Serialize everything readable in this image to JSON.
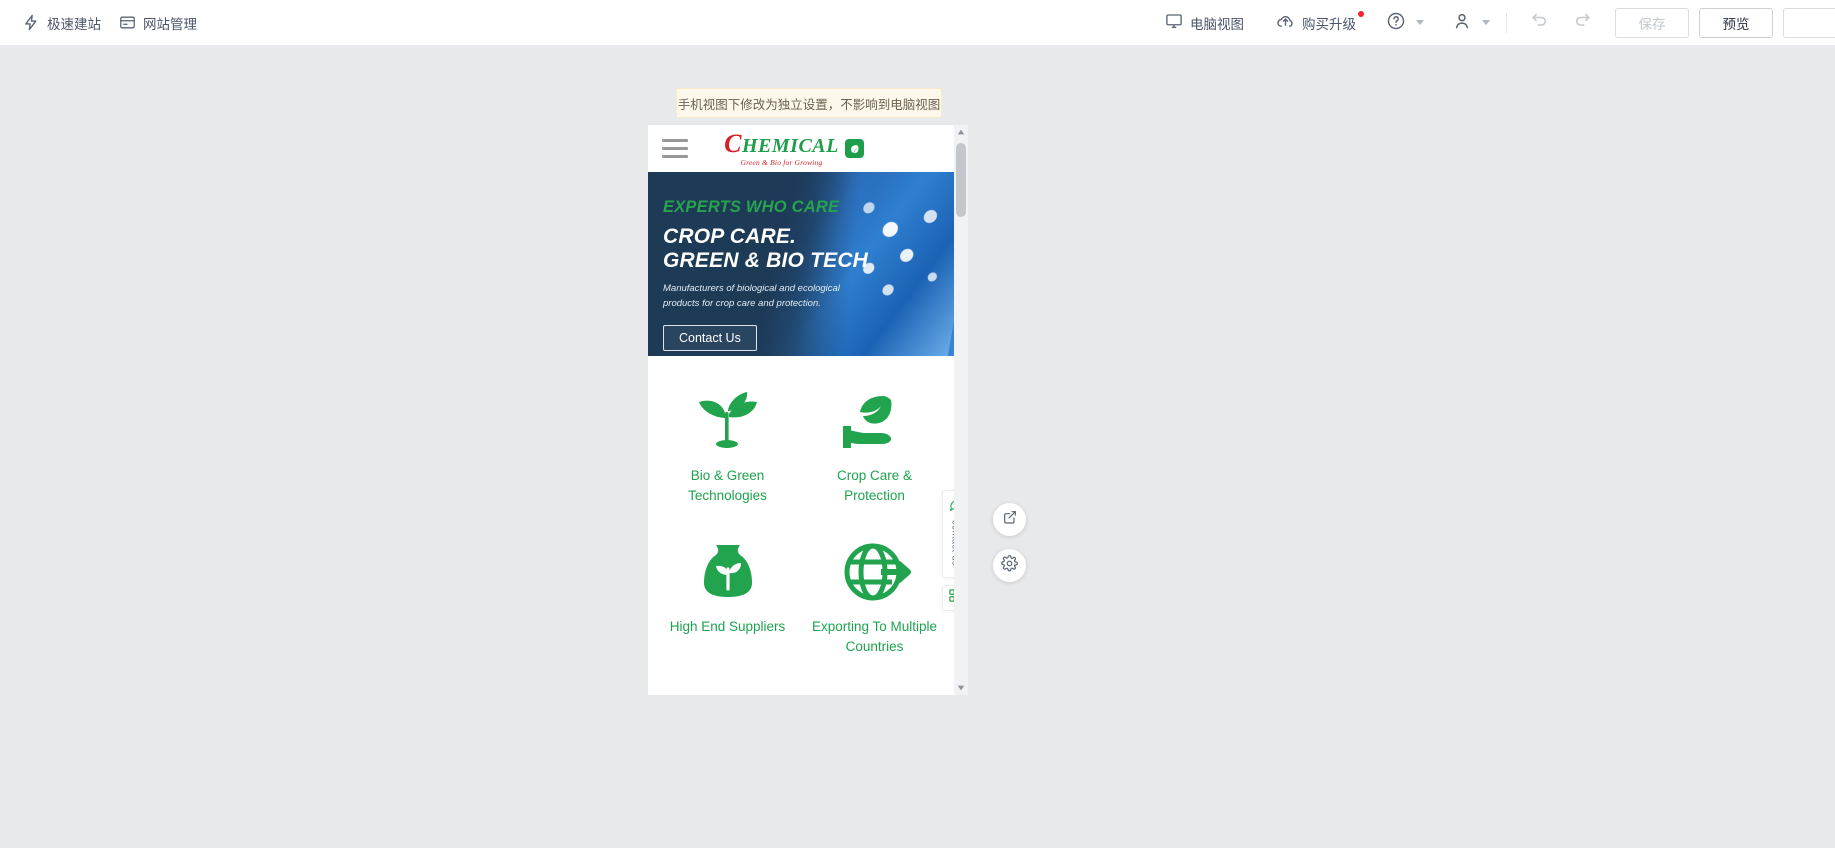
{
  "topbar": {
    "brand": {
      "icon": "lightning-icon",
      "label": "极速建站"
    },
    "site_manage": {
      "icon": "window-icon",
      "label": "网站管理"
    },
    "desktop_view": {
      "icon": "monitor-icon",
      "label": "电脑视图"
    },
    "upgrade": {
      "icon": "cloud-upload-icon",
      "label": "购买升级",
      "badge": true
    },
    "help": {
      "icon": "question-circle-icon"
    },
    "account": {
      "icon": "user-icon"
    },
    "undo": {
      "icon": "undo-icon"
    },
    "redo": {
      "icon": "redo-icon"
    },
    "save_label": "保存",
    "preview_label": "预览",
    "third_label": ""
  },
  "notice": {
    "text": "手机视图下修改为独立设置，不影响到电脑视图"
  },
  "site": {
    "header": {
      "menu_icon": "hamburger-icon",
      "logo_initial": "C",
      "logo_rest": "HEMICAL",
      "logo_tagline": "Green & Bio for Growing",
      "logo_badge_icon": "leaf-badge-icon"
    },
    "hero": {
      "eyebrow": "EXPERTS WHO CARE",
      "title_line1": "CROP CARE.",
      "title_line2": "GREEN & BIO TECH",
      "subtitle": "Manufacturers of biological and ecological products for crop care and protection.",
      "cta_label": "Contact Us"
    },
    "features": [
      {
        "icon": "seedling-icon",
        "label": "Bio & Green Technologies"
      },
      {
        "icon": "hand-leaf-icon",
        "label": "Crop Care & Protection"
      },
      {
        "icon": "fertilizer-bag-icon",
        "label": "High End Suppliers"
      },
      {
        "icon": "globe-arrow-icon",
        "label": "Exporting To Multiple Countries"
      }
    ],
    "widgets": {
      "contact_tab": {
        "icon": "chat-bubble-icon",
        "label": "contact us"
      },
      "qr_tab": {
        "icon": "qr-code-icon"
      }
    }
  },
  "floating_tools": [
    {
      "icon": "share-external-icon"
    },
    {
      "icon": "gear-icon"
    }
  ],
  "colors": {
    "brand_green": "#1da34e",
    "brand_red": "#d62027",
    "hero_navy": "#1d3a57",
    "notice_bg": "#fdf8ec"
  }
}
